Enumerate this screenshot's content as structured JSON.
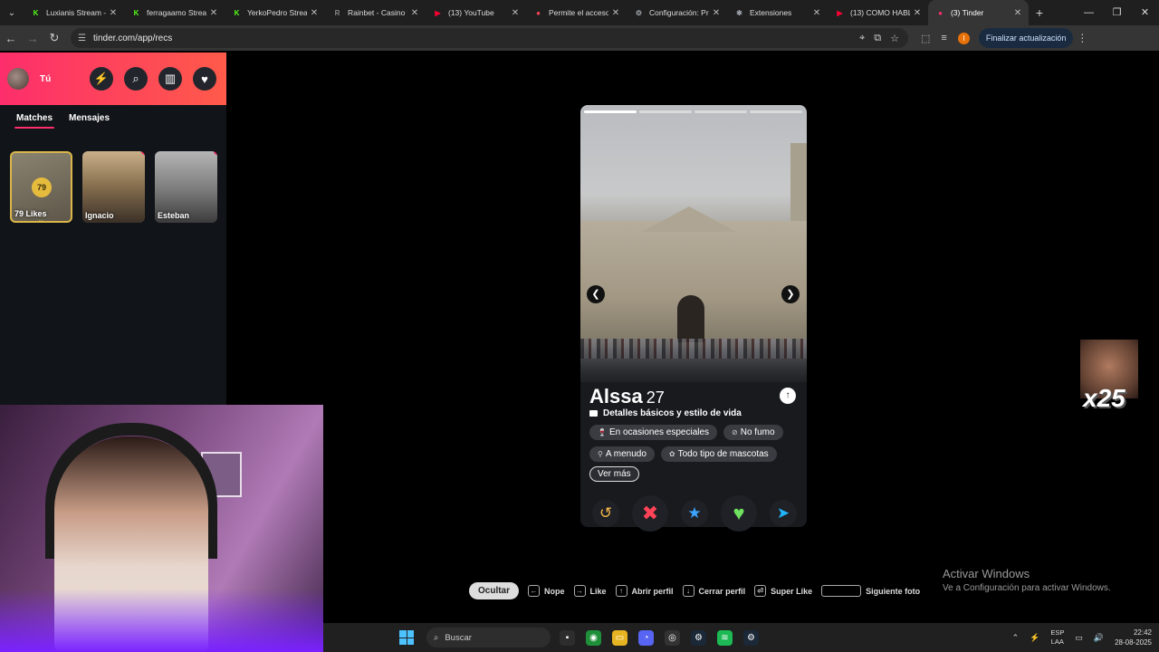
{
  "browser": {
    "tabs": [
      {
        "title": "Luxianis Stream -",
        "icon_color": "#53fc18",
        "icon": "K"
      },
      {
        "title": "ferragaamo Strea",
        "icon_color": "#53fc18",
        "icon": "K"
      },
      {
        "title": "YerkoPedro Strea",
        "icon_color": "#53fc18",
        "icon": "K"
      },
      {
        "title": "Rainbet - Casino y",
        "icon_color": "#888888",
        "icon": "R"
      },
      {
        "title": "(13) YouTube",
        "icon_color": "#ff0033",
        "icon": "▶"
      },
      {
        "title": "Permite el acceso",
        "icon_color": "#ff4458",
        "icon": "●"
      },
      {
        "title": "Configuración: Pr",
        "icon_color": "#9aa0a6",
        "icon": "⚙"
      },
      {
        "title": "Extensiones",
        "icon_color": "#9aa0a6",
        "icon": "✱"
      },
      {
        "title": "(13) COMO HABL",
        "icon_color": "#ff0033",
        "icon": "▶"
      },
      {
        "title": "(3) Tinder",
        "icon_color": "#fd2e6b",
        "icon": "●",
        "active": true
      }
    ],
    "url": "tinder.com/app/recs",
    "update_label": "Finalizar actualización",
    "profile_initial": "I"
  },
  "sidebar": {
    "user_label": "Tú",
    "tabs": [
      "Matches",
      "Mensajes"
    ],
    "likes": {
      "count": "79",
      "label": "79 Likes"
    },
    "matches": [
      {
        "name": "Ignacio"
      },
      {
        "name": "Esteban"
      }
    ]
  },
  "card": {
    "name": "Alssa",
    "age": "27",
    "details_label": "Detalles básicos y estilo de vida",
    "chips": [
      {
        "icon": "glass-icon",
        "label": "En ocasiones especiales"
      },
      {
        "icon": "no-smoking-icon",
        "label": "No fumo"
      },
      {
        "icon": "dumbbell-icon",
        "label": "A menudo"
      },
      {
        "icon": "paw-icon",
        "label": "Todo tipo de mascotas"
      }
    ],
    "more_label": "Ver más"
  },
  "shortcuts": {
    "hide_label": "Ocultar",
    "items": [
      {
        "key": "←",
        "label": "Nope"
      },
      {
        "key": "→",
        "label": "Like"
      },
      {
        "key": "↑",
        "label": "Abrir perfil"
      },
      {
        "key": "↓",
        "label": "Cerrar perfil"
      },
      {
        "key": "⏎",
        "label": "Super Like"
      },
      {
        "key": "",
        "label": "Siguiente foto"
      }
    ]
  },
  "overlay": {
    "emote_text": "x25",
    "activate_title": "Activar Windows",
    "activate_sub": "Ve a Configuración para activar Windows."
  },
  "taskbar": {
    "search_placeholder": "Buscar",
    "lang_top": "ESP",
    "lang_bottom": "LAA",
    "time": "22:42",
    "date": "28-08-2025"
  },
  "colors": {
    "tinder_gradient_start": "#fd2e6b",
    "tinder_gradient_end": "#ff5a4a",
    "likes_gold": "#e5bb3d"
  }
}
